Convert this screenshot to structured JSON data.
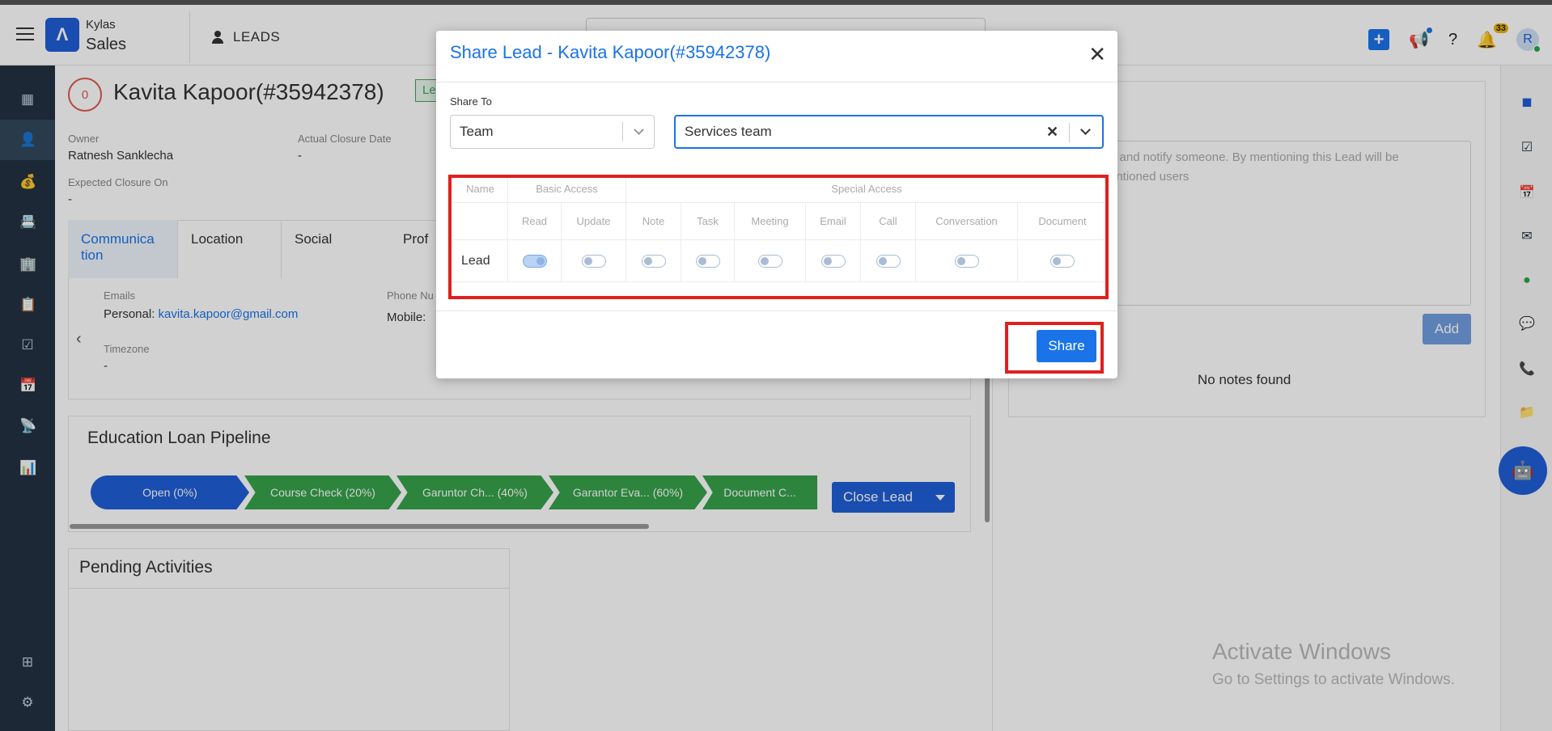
{
  "app": {
    "brand_top": "Kylas",
    "brand_bottom": "Sales",
    "section": "LEADS",
    "notification_count": "33",
    "avatar_initial": "R"
  },
  "lead": {
    "score": "0",
    "name": "Kavita Kapoor(#35942378)",
    "tag": "Le",
    "owner_label": "Owner",
    "owner_value": "Ratnesh Sanklecha",
    "closure_label": "Actual Closure Date",
    "closure_value": "-",
    "expected_label": "Expected Closure On",
    "expected_value": "-"
  },
  "tabs": [
    "Communica tion",
    "Location",
    "Social",
    "Prof"
  ],
  "communication": {
    "emails_label": "Emails",
    "email_prefix": "Personal:",
    "email_value": "kavita.kapoor@gmail.com",
    "phone_label": "Phone Nu",
    "phone_prefix": "Mobile:",
    "timezone_label": "Timezone",
    "timezone_value": "-"
  },
  "pipeline": {
    "title": "Education Loan Pipeline",
    "stages": [
      "Open (0%)",
      "Course Check (20%)",
      "Garuntor Ch... (40%)",
      "Garantor Eva... (60%)",
      "Document C..."
    ],
    "close_label": "Close Lead"
  },
  "pending": {
    "title": "Pending Activities"
  },
  "notes": {
    "placeholder_line1": "n and notify someone. By mentioning this Lead will be",
    "placeholder_line2": "entioned users",
    "add_label": "Add",
    "empty": "No notes found"
  },
  "watermark": {
    "line1": "Activate Windows",
    "line2": "Go to Settings to activate Windows."
  },
  "modal": {
    "title": "Share Lead - Kavita Kapoor(#35942378)",
    "share_to_label": "Share To",
    "share_type": "Team",
    "share_target": "Services team",
    "table": {
      "name_header": "Name",
      "basic_header": "Basic Access",
      "special_header": "Special Access",
      "columns": [
        "Read",
        "Update",
        "Note",
        "Task",
        "Meeting",
        "Email",
        "Call",
        "Conversation",
        "Document"
      ],
      "row_name": "Lead",
      "toggles": [
        true,
        false,
        false,
        false,
        false,
        false,
        false,
        false,
        false
      ]
    },
    "share_label": "Share"
  },
  "colors": {
    "primary": "#1a73e8",
    "sidebar": "#233142",
    "highlight": "#e0201e",
    "stage_green": "#36a24b",
    "stage_blue": "#1f5fd6"
  }
}
